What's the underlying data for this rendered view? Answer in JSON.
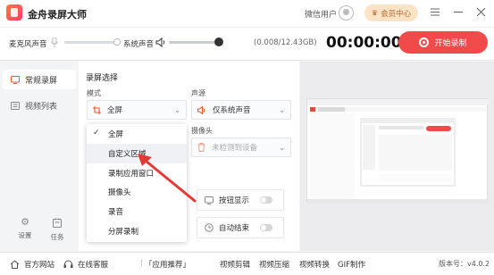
{
  "app": {
    "title": "金舟录屏大师",
    "user": "微信用户",
    "member_button": "会员中心"
  },
  "controls": {
    "mic_label": "麦克风声音",
    "sys_label": "系统声音",
    "storage": "(0.008/12.43GB)",
    "timer": "00:00:00",
    "start_button": "开始录制"
  },
  "sidebar": {
    "items": [
      {
        "label": "常规录屏",
        "icon": "screen-record-icon",
        "active": true
      },
      {
        "label": "视频列表",
        "icon": "list-icon",
        "active": false
      }
    ],
    "bottom": [
      {
        "label": "设置",
        "icon": "gear-icon"
      },
      {
        "label": "任务",
        "icon": "task-icon"
      }
    ]
  },
  "record": {
    "section_title": "录屏选择",
    "mode_label": "模式",
    "mode_value": "全屏",
    "audio_label": "声源",
    "audio_value": "仅系统声音",
    "camera_label": "摄像头",
    "camera_value": "未检测到设备",
    "mode_options": [
      "全屏",
      "自定义区域",
      "录制应用窗口",
      "摄像头",
      "录音",
      "分屏录制"
    ],
    "selected_index": 0,
    "hover_index": 1,
    "button_display": "按钮显示",
    "auto_end": "自动结束"
  },
  "footer": {
    "official_site": "官方网站",
    "online_service": "在线客服",
    "recommend": "「应用推荐」",
    "links": [
      "视频剪辑",
      "视频压缩",
      "视频转换",
      "GIF制作"
    ],
    "version": "版本号：v4.0.2"
  },
  "colors": {
    "accent": "#f04a4a",
    "member_bg": "#fde3c6",
    "arrow": "#e53935"
  }
}
